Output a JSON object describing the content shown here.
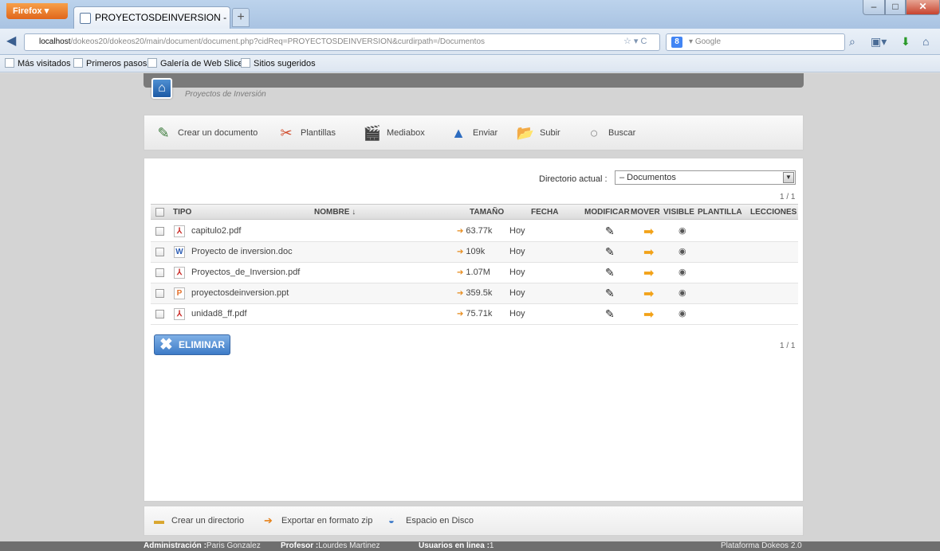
{
  "browser": {
    "menu_label": "Firefox",
    "tab_title": "PROYECTOSDEINVERSION - Maestria en ...",
    "new_tab": "+",
    "url_host": "localhost",
    "url_path": "/dokeos20/dokeos20/main/document/document.php?cidReq=PROYECTOSDEINVERSION&curdirpath=/Documentos",
    "search_placeholder": "Google",
    "bookmarks": [
      "Más visitados",
      "Primeros pasos",
      "Galería de Web Slice",
      "Sitios sugeridos"
    ]
  },
  "page": {
    "breadcrumb": "Proyectos de Inversión",
    "toolbar": {
      "crear_documento": "Crear un documento",
      "plantillas": "Plantillas",
      "mediabox": "Mediabox",
      "enviar": "Enviar",
      "subir": "Subir",
      "buscar": "Buscar"
    },
    "directory": {
      "label": "Directorio actual :",
      "value": "– Documentos"
    },
    "pager_top": "1 / 1",
    "pager_bottom": "1 / 1",
    "columns": {
      "tipo": "TIPO",
      "nombre": "NOMBRE ↓",
      "tamano": "TAMAÑO",
      "fecha": "FECHA",
      "modificar": "MODIFICAR",
      "mover": "MOVER",
      "visible": "VISIBLE",
      "plantilla": "PLANTILLA",
      "lecciones": "LECCIONES"
    },
    "files": [
      {
        "name": "capitulo2.pdf",
        "type": "pdf",
        "size": "63.77k",
        "date": "Hoy"
      },
      {
        "name": "Proyecto de inversion.doc",
        "type": "doc",
        "size": "109k",
        "date": "Hoy"
      },
      {
        "name": "Proyectos_de_Inversion.pdf",
        "type": "pdf",
        "size": "1.07M",
        "date": "Hoy"
      },
      {
        "name": "proyectosdeinversion.ppt",
        "type": "ppt",
        "size": "359.5k",
        "date": "Hoy"
      },
      {
        "name": "unidad8_ff.pdf",
        "type": "pdf",
        "size": "75.71k",
        "date": "Hoy"
      }
    ],
    "delete_button": "ELIMINAR",
    "bottom": {
      "crear_directorio": "Crear un directorio",
      "exportar_zip": "Exportar en formato zip",
      "espacio_disco": "Espacio en Disco"
    }
  },
  "footer": {
    "admin_label": "Administración :",
    "admin_name": "Paris Gonzalez",
    "profesor_label": "Profesor :",
    "profesor_name": "Lourdes Martinez",
    "usuarios_label": "Usuarios en linea :",
    "usuarios_count": "1",
    "platform": "Plataforma Dokeos 2.0"
  },
  "colors": {
    "accent_blue": "#3d7bc7",
    "footer_bg": "#6f6f6f",
    "move_orange": "#f2a218"
  },
  "icons": {
    "pdf": "pdf-icon",
    "doc": "doc-icon",
    "ppt": "ppt-icon"
  }
}
